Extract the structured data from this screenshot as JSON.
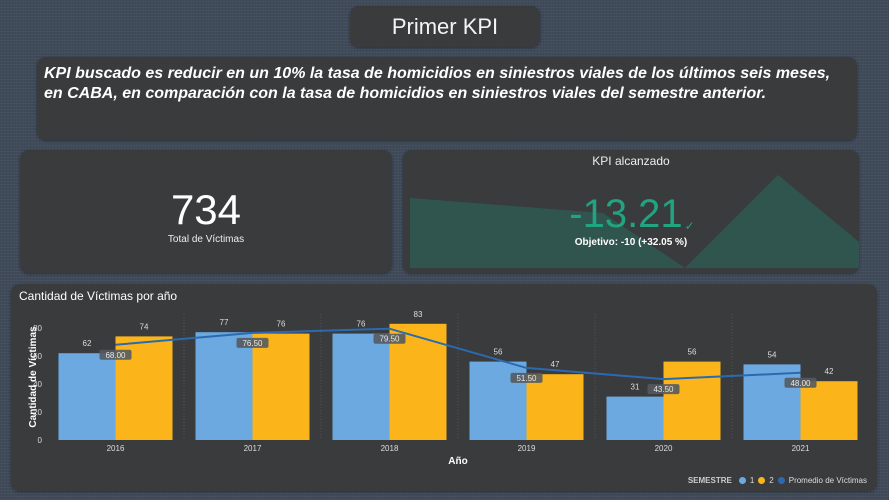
{
  "header": {
    "title": "Primer KPI"
  },
  "description": "KPI buscado es reducir en un 10% la tasa de homicidios en siniestros viales de los últimos seis meses, en CABA, en comparación con la tasa de homicidios en siniestros viales del semestre anterior.",
  "total_card": {
    "value": "734",
    "label": "Total de Víctimas"
  },
  "kpi_card": {
    "title": "KPI alcanzado",
    "value": "-13.21",
    "check": "✓",
    "goal": "Objetivo: -10 (+32.05 %)",
    "color": "#21a481"
  },
  "chart_data": {
    "type": "bar",
    "title": "Cantidad de Víctimas por año",
    "xlabel": "Año",
    "ylabel": "Cantidad de Víctimas",
    "ylim": [
      0,
      90
    ],
    "yticks": [
      0,
      20,
      40,
      60,
      80
    ],
    "categories": [
      "2016",
      "2017",
      "2018",
      "2019",
      "2020",
      "2021"
    ],
    "series": [
      {
        "name": "1",
        "color": "#6ba9e0",
        "values": [
          62,
          77,
          76,
          56,
          31,
          54
        ]
      },
      {
        "name": "2",
        "color": "#fbb51a",
        "values": [
          74,
          76,
          83,
          47,
          56,
          42
        ]
      }
    ],
    "line": {
      "name": "Promedio de Víctimas",
      "color": "#2b6ab0",
      "values": [
        68.0,
        76.5,
        79.5,
        51.5,
        43.5,
        48.0
      ],
      "labels": [
        "68.00",
        "76.50",
        "79.50",
        "51.50",
        "43.50",
        "48.00"
      ]
    },
    "legend": {
      "title": "SEMESTRE",
      "placement": "bottom-right"
    },
    "grid": false
  }
}
